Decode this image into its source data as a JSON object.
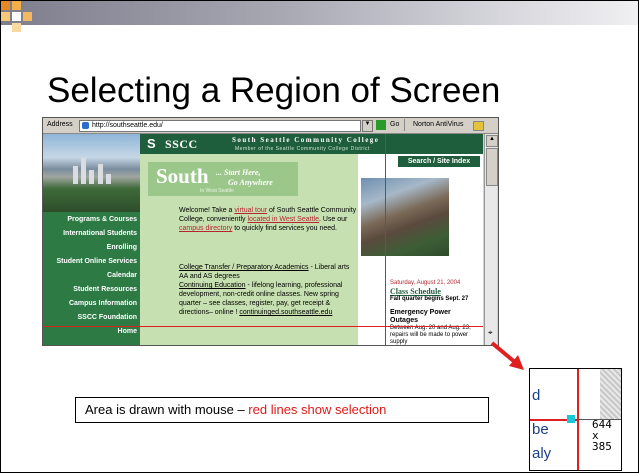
{
  "slide": {
    "title": "Selecting a Region of Screen",
    "caption_black": "Area is drawn with mouse – ",
    "caption_red": "red lines show selection",
    "colors": {
      "caption_red": "#e01818",
      "selection_line": "#e02020",
      "topbar_dark": "#7d7d8c",
      "logo_orange": "#e48a24"
    }
  },
  "browser": {
    "address_label": "Address",
    "address_url": "http://southseattle.edu/",
    "go_label": "Go",
    "toolbar_norton": "Norton AntiVirus",
    "icons": [
      "ie-page-icon",
      "go-arrow-icon",
      "norton-icon",
      "dropdown-arrow-icon"
    ]
  },
  "website": {
    "logo_letter": "S",
    "sscc": "SSCC",
    "college_name": "South Seattle Community College",
    "member_line": "Member of the Seattle Community College District",
    "search": "Search / Site Index",
    "south": "South",
    "tagline_1": "... Start Here,",
    "tagline_2": "Go Anywhere",
    "in_west_seattle": "In West Seattle",
    "nav": [
      "Programs & Courses",
      "International Students",
      "Enrolling",
      "Student Online Services",
      "Calendar",
      "Student Resources",
      "Campus Information",
      "SSCC Foundation",
      "Home"
    ],
    "welcome": {
      "t1": "Welcome! Take a ",
      "l1": "virtual tour",
      "t2": " of South Seattle Community College, conveniently ",
      "l2": "located in West Seattle",
      "t3": ". Use our ",
      "l3": "campus directory",
      "t4": " to quickly find services you need."
    },
    "college_transfer": "College Transfer / Preparatory Academics",
    "college_transfer_desc": " - Liberal arts AA and AS degrees",
    "continuing_ed": "Continuing Education",
    "continuing_ed_desc": " - lifelong learning, professional development, non-credit online classes. New spring quarter – see classes, register, pay, get receipt & directions– online ! ",
    "continuing_link": "continuinged.southseattle.edu",
    "news_date": "Saturday, August 21, 2004",
    "news_class": "Class Schedule",
    "news_fall": "Fall quarter begins Sept. 27",
    "news_emergency": "Emergency Power Outages",
    "news_body": "Between Aug. 20 and Aug. 23, repairs will be made to power supply"
  },
  "zoom": {
    "fragments": [
      "d",
      "be",
      "aly"
    ],
    "coord_1": "644",
    "coord_2": "x",
    "coord_3": "385"
  }
}
